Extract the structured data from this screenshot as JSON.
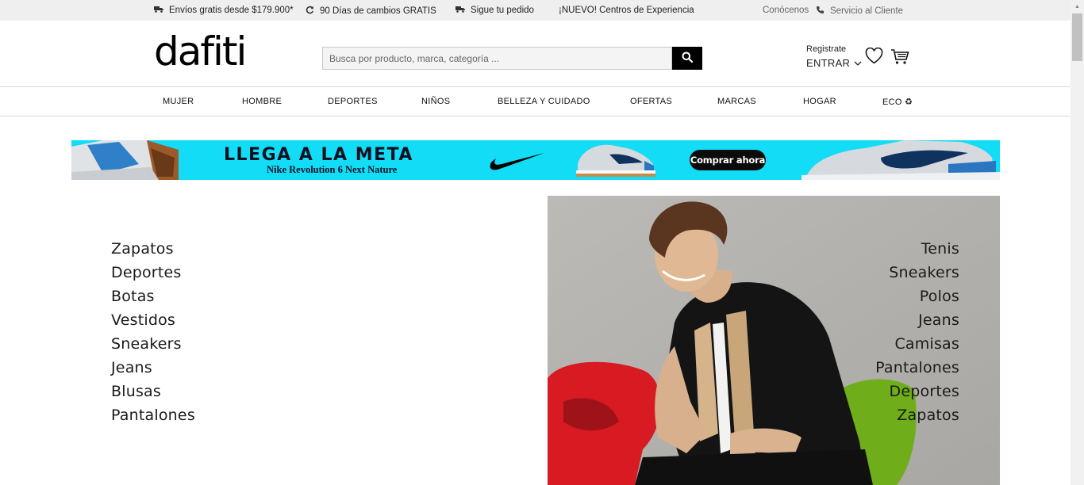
{
  "topbar": {
    "items": [
      {
        "icon": "truck-icon",
        "label": "Envíos gratis desde $179.900*"
      },
      {
        "icon": "refresh-icon",
        "label": "90 Días de cambios GRATIS"
      },
      {
        "icon": "truck-icon",
        "label": "Sigue tu pedido"
      },
      {
        "icon": "",
        "label": "¡NUEVO! Centros de Experiencia"
      }
    ],
    "about": "Conócenos",
    "service": "Servicio al Cliente"
  },
  "header": {
    "logo": "dafiti",
    "search_placeholder": "Busca por producto, marca, categoría ...",
    "register": "Registrate",
    "login": "ENTRAR"
  },
  "nav": [
    "MUJER",
    "HOMBRE",
    "DEPORTES",
    "NIÑOS",
    "BELLEZA Y CUIDADO",
    "OFERTAS",
    "MARCAS",
    "HOGAR",
    "ECO ♻"
  ],
  "banner": {
    "title": "LLEGA A LA META",
    "subtitle": "Nike Revolution 6 Next Nature",
    "cta": "Comprar ahora",
    "bg_color": "#12dcf6"
  },
  "left_categories": [
    "Zapatos",
    "Deportes",
    "Botas",
    "Vestidos",
    "Sneakers",
    "Jeans",
    "Blusas",
    "Pantalones"
  ],
  "right_categories": [
    "Tenis",
    "Sneakers",
    "Polos",
    "Jeans",
    "Camisas",
    "Pantalones",
    "Deportes",
    "Zapatos"
  ]
}
